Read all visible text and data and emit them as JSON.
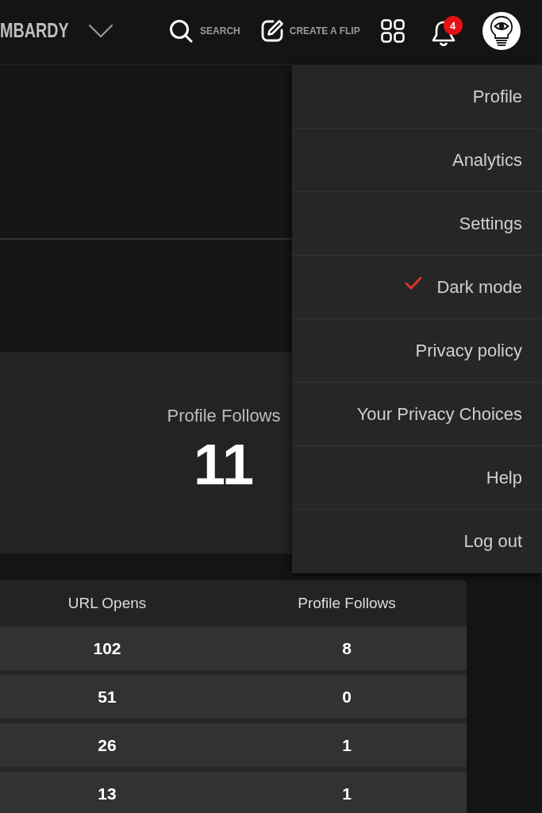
{
  "header": {
    "title": "MBARDY",
    "search_button": {
      "label": "SEARCH"
    },
    "create_button": {
      "label": "CREATE A FLIP"
    },
    "notifications": {
      "badge": "4"
    }
  },
  "stat_card": {
    "label": "Profile Follows",
    "value": "11"
  },
  "table": {
    "columns": [
      "URL Opens",
      "Profile Follows"
    ],
    "rows": [
      [
        "102",
        "8"
      ],
      [
        "51",
        "0"
      ],
      [
        "26",
        "1"
      ],
      [
        "13",
        "1"
      ]
    ]
  },
  "menu": {
    "items": [
      {
        "label": "Profile",
        "checked": false
      },
      {
        "label": "Analytics",
        "checked": false
      },
      {
        "label": "Settings",
        "checked": false
      },
      {
        "label": "Dark mode",
        "checked": true
      },
      {
        "label": "Privacy policy",
        "checked": false
      },
      {
        "label": "Your Privacy Choices",
        "checked": false
      },
      {
        "label": "Help",
        "checked": false
      },
      {
        "label": "Log out",
        "checked": false
      }
    ]
  }
}
